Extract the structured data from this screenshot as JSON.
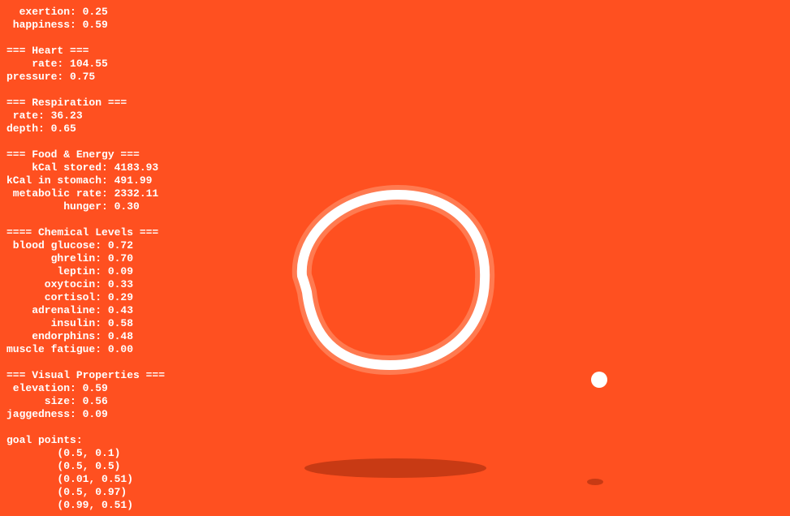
{
  "background_color": "#FF5020",
  "text_color": "#FFFFFF",
  "stats_lines": [
    "  exertion: 0.25",
    " happiness: 0.59",
    "",
    "=== Heart ===",
    "    rate: 104.55",
    "pressure: 0.75",
    "",
    "=== Respiration ===",
    " rate: 36.23",
    "depth: 0.65",
    "",
    "=== Food & Energy ===",
    "    kCal stored: 4183.93",
    "kCal in stomach: 491.99",
    " metabolic rate: 2332.11",
    "         hunger: 0.30",
    "",
    "==== Chemical Levels ===",
    " blood glucose: 0.72",
    "       ghrelin: 0.70",
    "        leptin: 0.09",
    "      oxytocin: 0.33",
    "      cortisol: 0.29",
    "    adrenaline: 0.43",
    "       insulin: 0.58",
    "    endorphins: 0.48",
    "muscle fatigue: 0.00",
    "",
    "=== Visual Properties ===",
    " elevation: 0.59",
    "      size: 0.56",
    "jaggedness: 0.09",
    "",
    "goal points:",
    "        (0.5, 0.1)",
    "        (0.5, 0.5)",
    "        (0.01, 0.51)",
    "        (0.5, 0.97)",
    "        (0.99, 0.51)"
  ],
  "scene": {
    "creature_stroke_color": "#FFFFFF",
    "creature_glow_color": "#FF7A50",
    "shadow_color": "#C83A14",
    "food_color": "#FFFFFF"
  }
}
